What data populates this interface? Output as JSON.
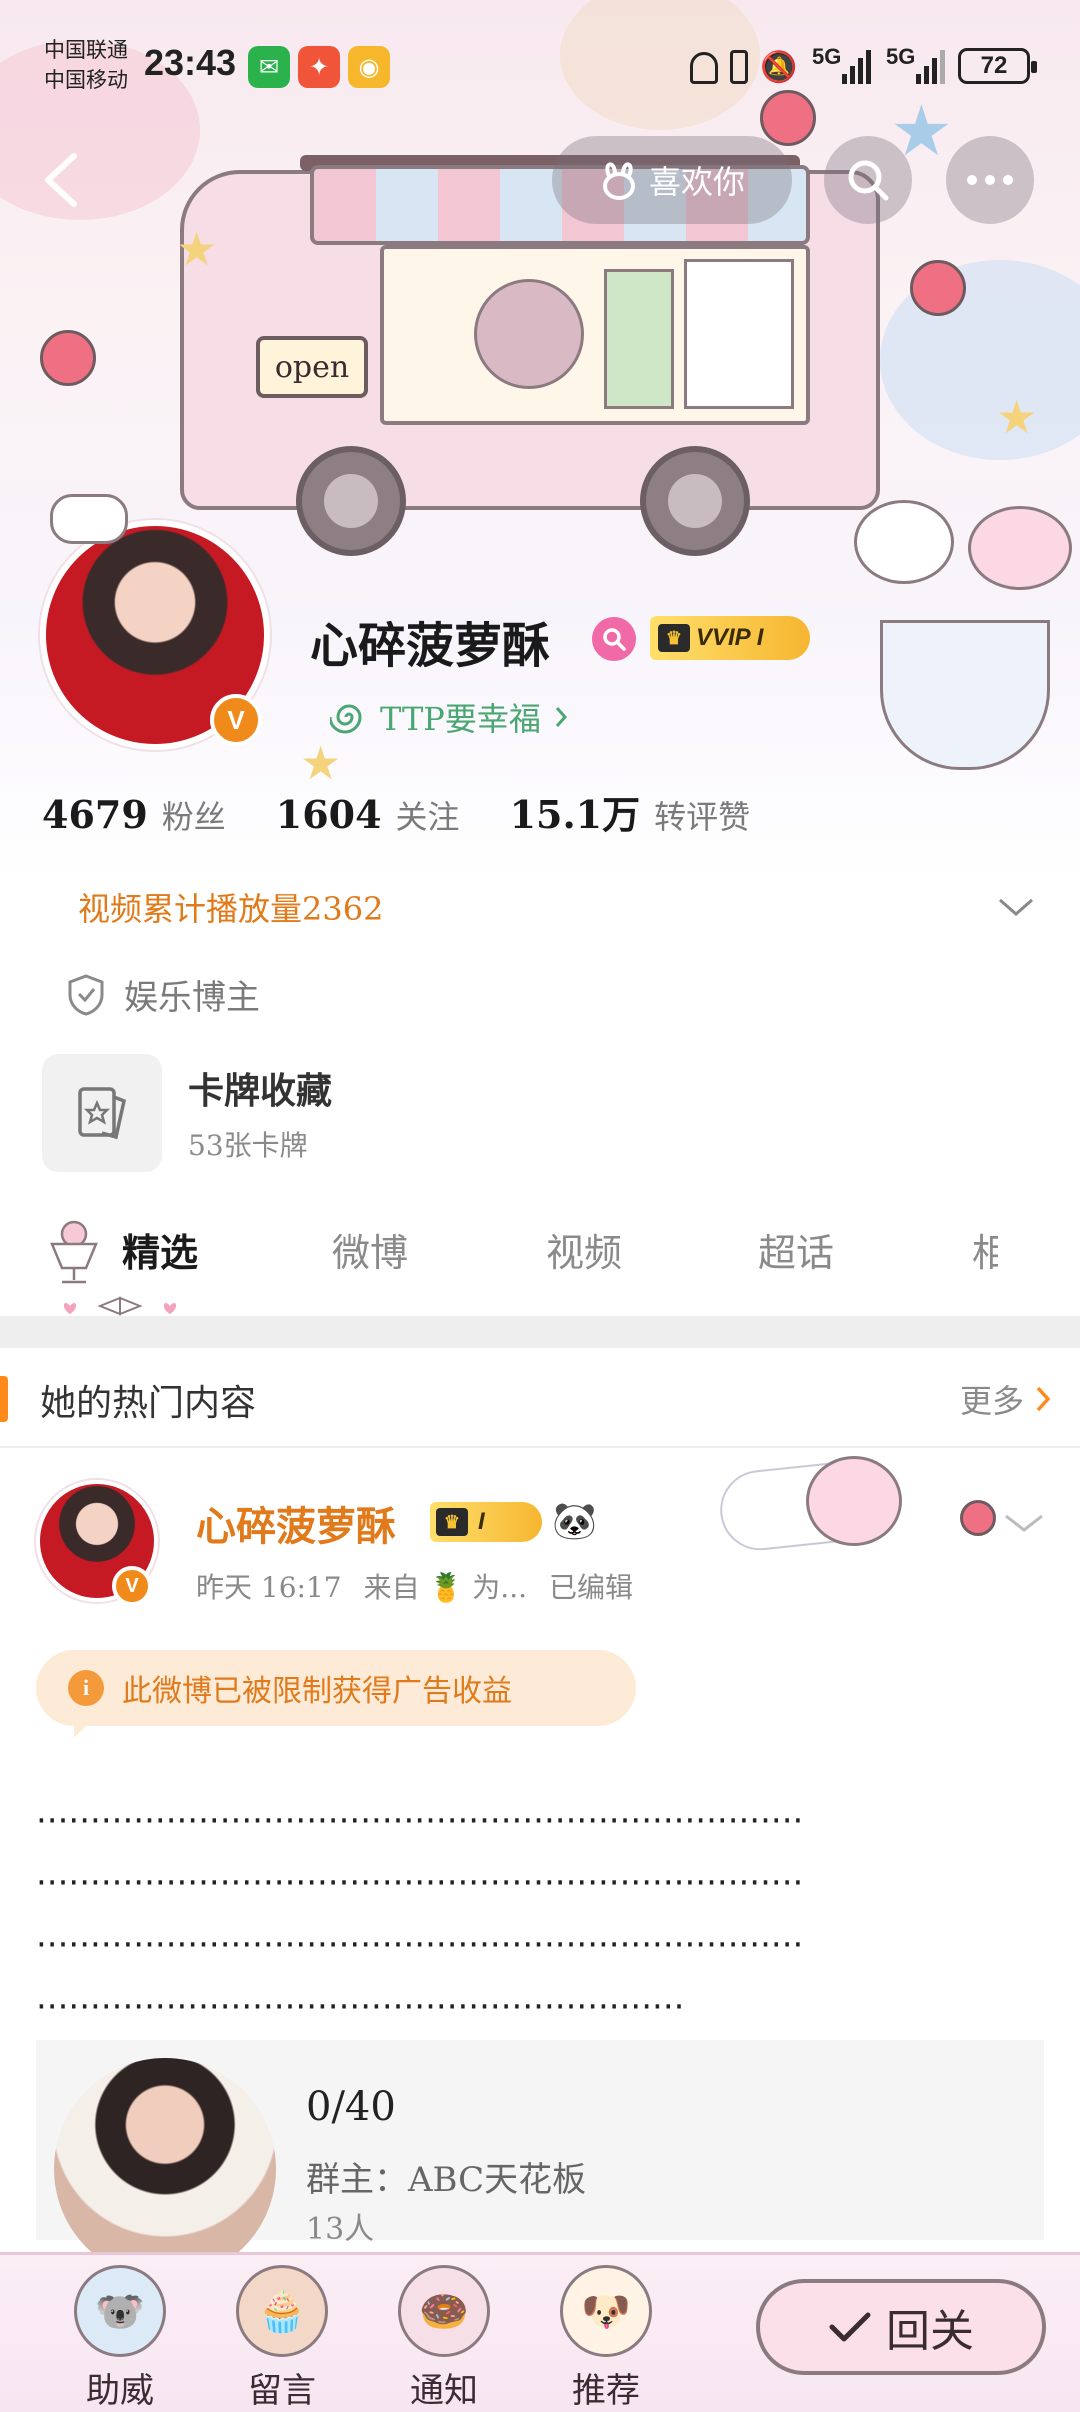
{
  "status_bar": {
    "carrier_1": "中国联通",
    "carrier_2": "中国移动",
    "time": "23:43",
    "sig_1": "5G",
    "sig_2": "5G",
    "battery": "72"
  },
  "nav": {
    "like_label": "喜欢你"
  },
  "banner": {
    "open_sign": "open"
  },
  "profile": {
    "name": "心碎菠萝酥",
    "vvip_label": "VVIP",
    "vvip_level": "I",
    "ttp_text": "TTP要幸福",
    "verified_glyph": "V"
  },
  "stats": [
    {
      "value": "4679",
      "label": "粉丝"
    },
    {
      "value": "1604",
      "label": "关注"
    },
    {
      "value": "15.1万",
      "label": "转评赞"
    }
  ],
  "video_play_count": "视频累计播放量2362",
  "tag": "娱乐博主",
  "card": {
    "title": "卡牌收藏",
    "subtitle": "53张卡牌"
  },
  "tabs": [
    {
      "label": "精选",
      "active": true
    },
    {
      "label": "微博",
      "active": false
    },
    {
      "label": "视频",
      "active": false
    },
    {
      "label": "超话",
      "active": false
    },
    {
      "label": "相",
      "active": false
    }
  ],
  "hot_section": {
    "title": "她的热门内容",
    "more": "更多"
  },
  "post": {
    "name": "心碎菠萝酥",
    "level": "I",
    "time": "昨天 16:17",
    "source_prefix": "来自",
    "source_name": "为...",
    "edited": "已编辑",
    "ad_notice": "此微博已被限制获得广告收益",
    "body_lines": [
      "·······································································",
      "·······································································",
      "·······································································",
      "····························································"
    ]
  },
  "group": {
    "title": "0/40",
    "owner": "群主：ABC天花板",
    "count": "13人"
  },
  "bottom_bar": {
    "items": [
      {
        "label": "助威",
        "icon": "cheer-icon"
      },
      {
        "label": "留言",
        "icon": "message-icon"
      },
      {
        "label": "通知",
        "icon": "notify-icon"
      },
      {
        "label": "推荐",
        "icon": "recommend-icon"
      }
    ],
    "follow_back": "回关"
  },
  "colors": {
    "accent_orange": "#e07a1a",
    "link_green": "#4aa673",
    "vvip_gold": "#f6b631",
    "verified_orange": "#f08a1b"
  }
}
